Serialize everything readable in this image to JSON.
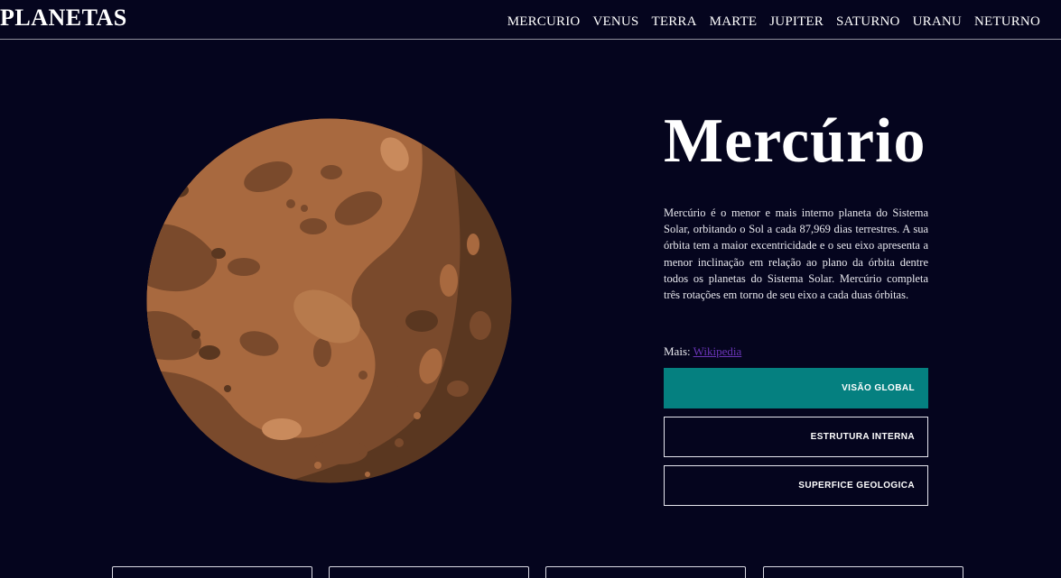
{
  "header": {
    "logo": "PLANETAS",
    "nav": [
      "MERCURIO",
      "VENUS",
      "TERRA",
      "MARTE",
      "JUPITER",
      "SATURNO",
      "URANU",
      "NETURNO"
    ]
  },
  "planet": {
    "name": "Mercúrio",
    "description": "Mercúrio é o menor e mais interno planeta do Sistema Solar, orbitando o Sol a cada 87,969 dias terrestres. A sua órbita tem a maior excentricidade e o seu eixo apresenta a menor inclinação em relação ao plano da órbita dentre todos os planetas do Sistema Solar. Mercúrio completa três rotações em torno de seu eixo a cada duas órbitas.",
    "more_label": "Mais:",
    "more_link": "Wikipedia",
    "colors": {
      "light": "#a8693f",
      "mid": "#7a4a2c",
      "dark": "#5a3720"
    }
  },
  "tabs": [
    {
      "label": "VISÃO GLOBAL",
      "active": true
    },
    {
      "label": "ESTRUTURA INTERNA",
      "active": false
    },
    {
      "label": "SUPERFICE GEOLOGICA",
      "active": false
    }
  ],
  "colors": {
    "background": "#05051e",
    "accent": "#058080"
  }
}
